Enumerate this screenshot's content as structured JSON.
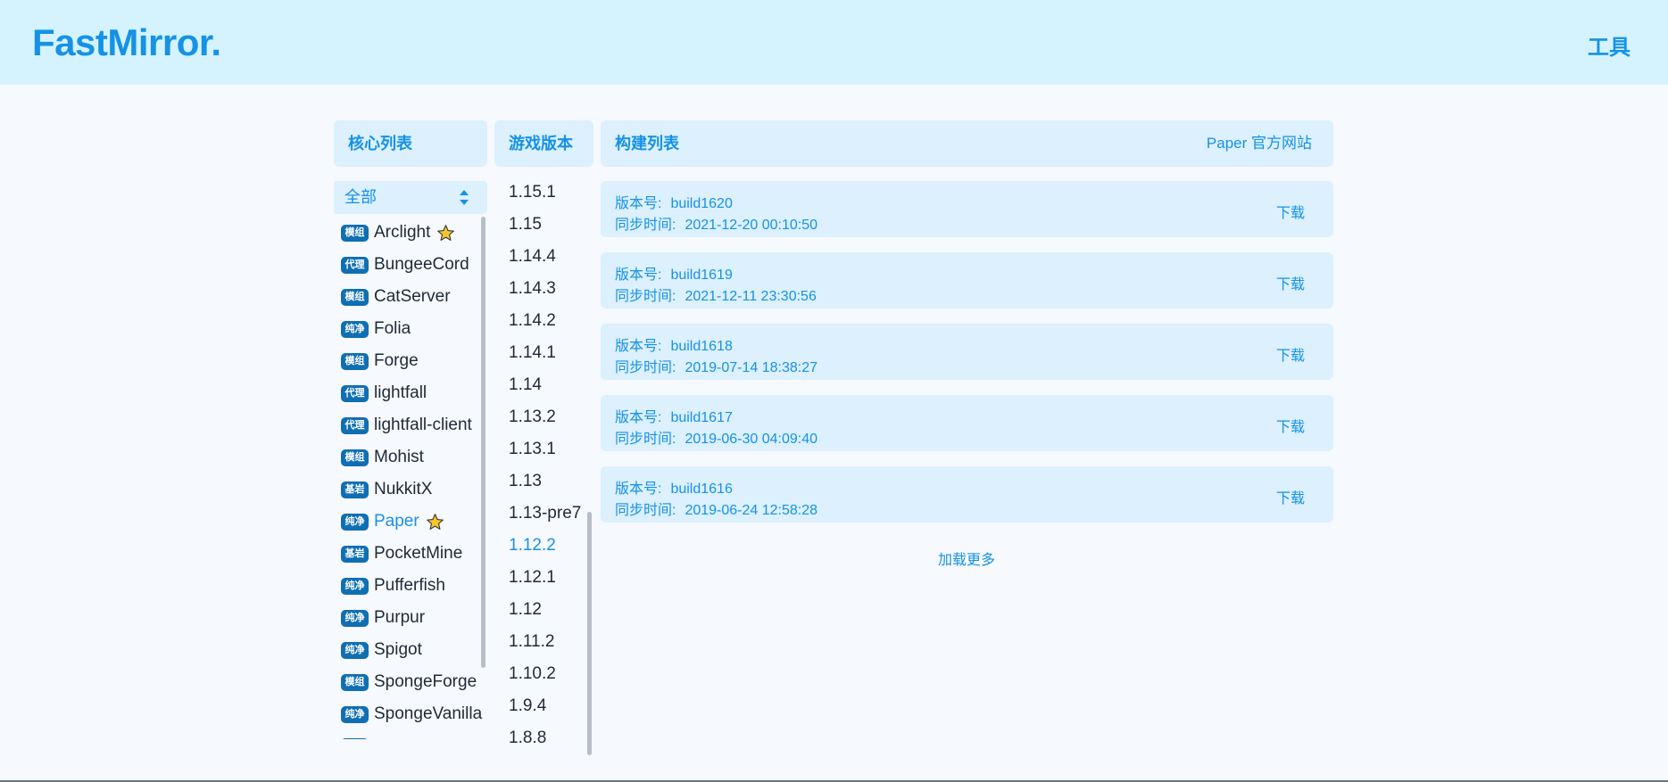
{
  "header": {
    "logo": "FastMirror.",
    "tools": "工具"
  },
  "core_panel": {
    "title": "核心列表",
    "filter_value": "全部",
    "items": [
      {
        "badge": "模组",
        "name": "Arclight",
        "starred": true
      },
      {
        "badge": "代理",
        "name": "BungeeCord",
        "starred": false
      },
      {
        "badge": "模组",
        "name": "CatServer",
        "starred": false
      },
      {
        "badge": "纯净",
        "name": "Folia",
        "starred": false
      },
      {
        "badge": "模组",
        "name": "Forge",
        "starred": false
      },
      {
        "badge": "代理",
        "name": "lightfall",
        "starred": false
      },
      {
        "badge": "代理",
        "name": "lightfall-client",
        "starred": false
      },
      {
        "badge": "模组",
        "name": "Mohist",
        "starred": false
      },
      {
        "badge": "基岩",
        "name": "NukkitX",
        "starred": false
      },
      {
        "badge": "纯净",
        "name": "Paper",
        "starred": true,
        "active": true
      },
      {
        "badge": "基岩",
        "name": "PocketMine",
        "starred": false
      },
      {
        "badge": "纯净",
        "name": "Pufferfish",
        "starred": false
      },
      {
        "badge": "纯净",
        "name": "Purpur",
        "starred": false
      },
      {
        "badge": "纯净",
        "name": "Spigot",
        "starred": false
      },
      {
        "badge": "模组",
        "name": "SpongeForge",
        "starred": false
      },
      {
        "badge": "纯净",
        "name": "SpongeVanilla",
        "starred": false
      }
    ]
  },
  "version_panel": {
    "title": "游戏版本",
    "items": [
      "1.15.1",
      "1.15",
      "1.14.4",
      "1.14.3",
      "1.14.2",
      "1.14.1",
      "1.14",
      "1.13.2",
      "1.13.1",
      "1.13",
      "1.13-pre7",
      "1.12.2",
      "1.12.1",
      "1.12",
      "1.11.2",
      "1.10.2",
      "1.9.4",
      "1.8.8"
    ],
    "active": "1.12.2"
  },
  "build_panel": {
    "title": "构建列表",
    "official_link": "Paper 官方网站",
    "version_label": "版本号:",
    "sync_label": "同步时间:",
    "download_label": "下载",
    "load_more": "加载更多",
    "builds": [
      {
        "version": "build1620",
        "sync_time": "2021-12-20 00:10:50"
      },
      {
        "version": "build1619",
        "sync_time": "2021-12-11 23:30:56"
      },
      {
        "version": "build1618",
        "sync_time": "2019-07-14 18:38:27"
      },
      {
        "version": "build1617",
        "sync_time": "2019-06-30 04:09:40"
      },
      {
        "version": "build1616",
        "sync_time": "2019-06-24 12:58:28"
      }
    ]
  },
  "colors": {
    "header_bg": "#d4f3ff",
    "accent": "#1592e6",
    "panel_bg": "#dcf0fd",
    "badge_bg": "#0f6fb2",
    "page_bg": "#f6f9fd"
  },
  "icons": {
    "select_arrows": "sort-arrows-icon",
    "favorite": "star-icon"
  }
}
